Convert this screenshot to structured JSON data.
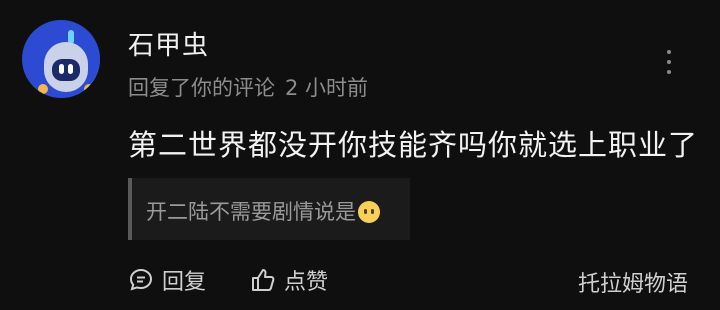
{
  "comment": {
    "username": "石甲虫",
    "action_text": "回复了你的评论",
    "time": "2 小时前",
    "content": "第二世界都没开你技能齐吗你就选上职业了",
    "quoted_text": "开二陆不需要剧情说是"
  },
  "actions": {
    "reply_label": "回复",
    "like_label": "点赞"
  },
  "brand": "托拉姆物语",
  "icons": {
    "avatar": "robot-avatar",
    "more": "more-vertical-icon",
    "reply": "chat-bubble-icon",
    "like": "thumbs-up-icon",
    "emoji": "smiling-face-emoji"
  },
  "colors": {
    "background": "#0f0f10",
    "quote_background": "#1b1b1c",
    "avatar": "#2d4bd2"
  }
}
